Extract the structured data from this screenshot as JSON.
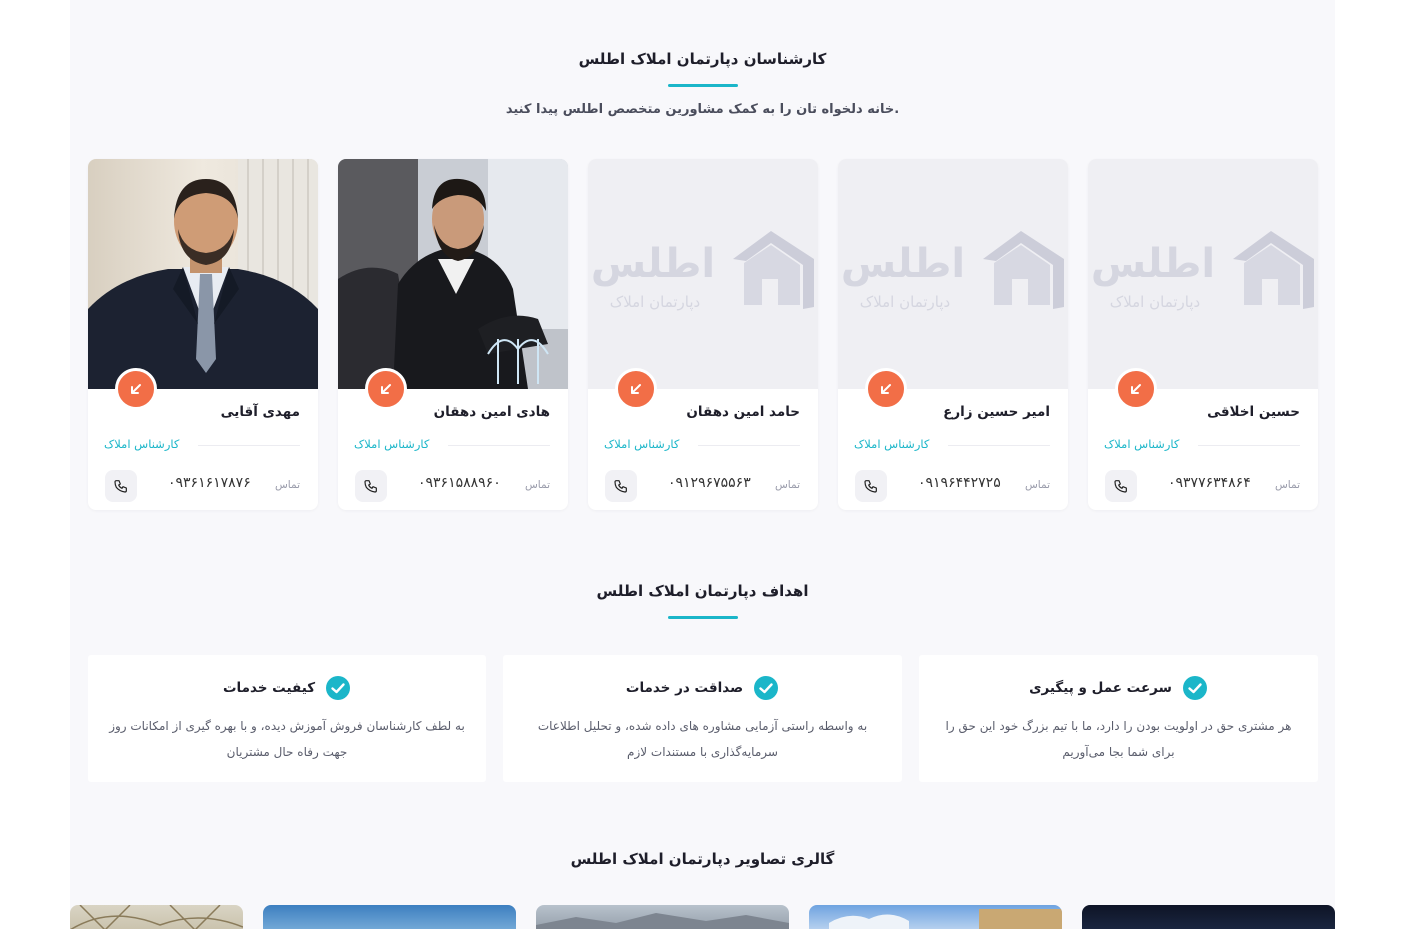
{
  "agents_section": {
    "title": "کارشناسان دپارتمان املاک اطلس",
    "subtitle": "خانه دلخواه تان را به کمک مشاورین متخصص اطلس پیدا کنید."
  },
  "placeholder_logo": {
    "word": "اطلس",
    "tagline": "دپارتمان املاک"
  },
  "agents": [
    {
      "name": "مهدی آقایی",
      "role": "کارشناس املاک",
      "contact_label": "تماس",
      "phone": "۰۹۳۶۱۶۱۷۸۷۶"
    },
    {
      "name": "هادی امین دهقان",
      "role": "کارشناس املاک",
      "contact_label": "تماس",
      "phone": "۰۹۳۶۱۵۸۸۹۶۰"
    },
    {
      "name": "حامد امین دهقان",
      "role": "کارشناس املاک",
      "contact_label": "تماس",
      "phone": "۰۹۱۲۹۶۷۵۵۶۳"
    },
    {
      "name": "امیر حسین زارع",
      "role": "کارشناس املاک",
      "contact_label": "تماس",
      "phone": "۰۹۱۹۶۴۴۲۷۲۵"
    },
    {
      "name": "حسین اخلاقی",
      "role": "کارشناس املاک",
      "contact_label": "تماس",
      "phone": "۰۹۳۷۷۶۳۴۸۶۴"
    }
  ],
  "goals_section": {
    "title": "اهداف دپارتمان املاک اطلس"
  },
  "goals": [
    {
      "title": "کیفیت خدمات",
      "text": "به لطف کارشناسان فروش آموزش دیده، و با بهره گیری از امکانات روز جهت رفاه حال مشتریان"
    },
    {
      "title": "صداقت در خدمات",
      "text": "به واسطه راستی آزمایی مشاوره های داده شده، و تحلیل اطلاعات سرمایه‌گذاری با مستندات لازم"
    },
    {
      "title": "سرعت عمل و پیگیری",
      "text": "هر مشتری حق در اولویت بودن را دارد، ما با تیم بزرگ خود این حق را برای شما بجا می‌آوریم"
    }
  ],
  "gallery_section": {
    "title": "گالری تصاویر دپارتمان املاک اطلس"
  },
  "colors": {
    "accent": "#1bb6c9",
    "arrow_button": "#f26e47",
    "page_bg": "#f8f8fb"
  },
  "icons": {
    "arrow": "arrow-down-left-icon",
    "phone": "phone-icon",
    "check": "check-badge-icon"
  }
}
